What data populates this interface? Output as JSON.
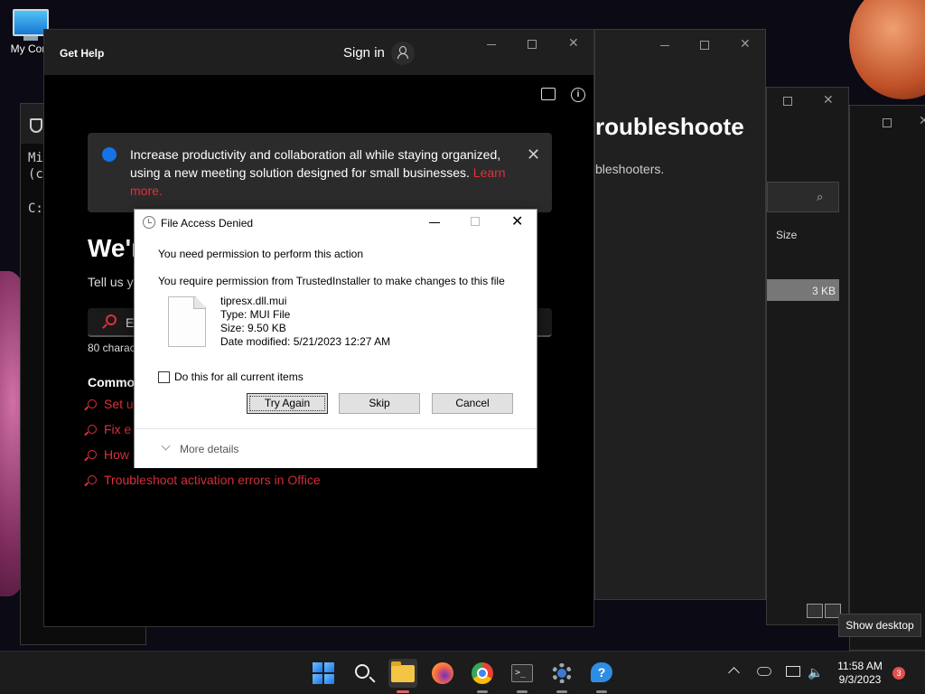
{
  "desktop": {
    "icon_label": "My Com"
  },
  "terminal": {
    "line1": "Mi",
    "line2": "(c",
    "line3": "C:"
  },
  "troubleshooter": {
    "title": "roubleshoote",
    "subtitle": "bleshooters."
  },
  "explorer": {
    "size_header": "Size",
    "row_size": "3 KB"
  },
  "get_help": {
    "title": "Get Help",
    "sign_in": "Sign in",
    "banner_text": "Increase productivity and collaboration all while staying organized, using a new meeting solution designed for small businesses.",
    "banner_link": "Learn more.",
    "heading": "We'r",
    "tell_us": "Tell us yo",
    "search_value": "Ex",
    "char_count": "80 charact",
    "common_heading": "Commo",
    "links": [
      {
        "label": "Set u"
      },
      {
        "label": "Fix e"
      },
      {
        "label": "How"
      },
      {
        "label": "Troubleshoot activation errors in Office"
      }
    ]
  },
  "dialog": {
    "title": "File Access Denied",
    "message": "You need permission to perform this action",
    "detail": "You require permission from TrustedInstaller to make changes to this file",
    "file_name": "tipresx.dll.mui",
    "file_type": "Type: MUI File",
    "file_size": "Size: 9.50 KB",
    "file_date": "Date modified: 5/21/2023 12:27 AM",
    "checkbox_label": "Do this for all current items",
    "checkbox_checked": false,
    "buttons": {
      "try_again": "Try Again",
      "skip": "Skip",
      "cancel": "Cancel"
    },
    "more_details": "More details"
  },
  "taskbar": {
    "apps": [
      "start",
      "search",
      "file-explorer",
      "firefox",
      "chrome",
      "terminal",
      "settings",
      "get-help"
    ],
    "active_app": "file-explorer",
    "time": "11:58 AM",
    "date": "9/3/2023",
    "notification_count": "3",
    "tooltip": "Show desktop"
  },
  "colors": {
    "accent_red": "#e0303a",
    "info_blue": "#1473e6",
    "taskbar_bg": "#1c1c1c"
  }
}
